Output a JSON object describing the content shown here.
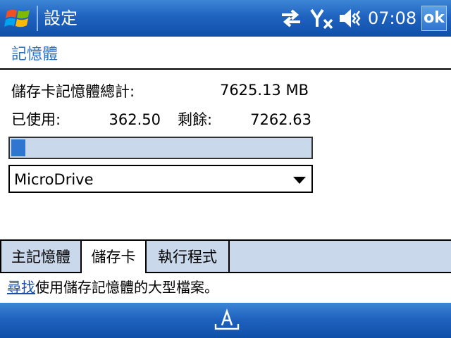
{
  "titlebar": {
    "title": "設定",
    "time": "07:08",
    "ok_label": "ok"
  },
  "header": {
    "title": "記憶體"
  },
  "storage": {
    "total_label": "儲存卡記憶體總計:",
    "total_value": "7625.13 MB",
    "used_label": "已使用:",
    "used_value": "362.50",
    "free_label": "剩餘:",
    "free_value": "7262.63",
    "used_fraction": 0.0475
  },
  "dropdown": {
    "selected": "MicroDrive"
  },
  "tabs": [
    {
      "label": "主記憶體"
    },
    {
      "label": "儲存卡"
    },
    {
      "label": "執行程式"
    }
  ],
  "help": {
    "link": "尋找",
    "text": "使用儲存記憶體的大型檔案。"
  },
  "colors": {
    "titlebar": "#1f63bf",
    "header_text": "#2f74c4",
    "progress_fill": "#3076d1",
    "tab_inactive": "#c9d8ea"
  }
}
